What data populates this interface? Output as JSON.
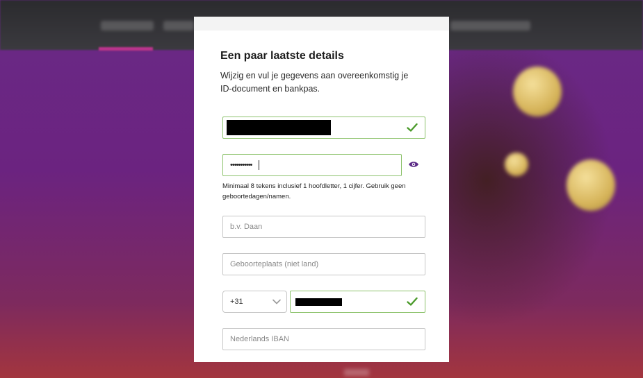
{
  "modal": {
    "title": "Een paar laatste details",
    "subtitle": "Wijzig en vul je gegevens aan overeenkomstig je ID-document en bankpas.",
    "password": {
      "masked_value": "•••••••••••",
      "hint": "Minimaal 8 tekens inclusief 1 hoofdletter, 1 cijfer. Gebruik geen geboortedagen/namen."
    },
    "first_name": {
      "placeholder": "b.v. Daan",
      "value": ""
    },
    "birthplace": {
      "placeholder": "Geboorteplaats (niet land)",
      "value": ""
    },
    "phone": {
      "country_code": "+31"
    },
    "iban": {
      "placeholder": "Nederlands IBAN",
      "value": ""
    }
  },
  "icons": {
    "valid": "check-icon",
    "password_toggle": "eye-icon",
    "dropdown": "chevron-down-icon"
  },
  "colors": {
    "valid_border": "#8cc26b",
    "valid_check": "#4a9a2a",
    "eye": "#5b2a86",
    "background": "#6a2a86"
  }
}
